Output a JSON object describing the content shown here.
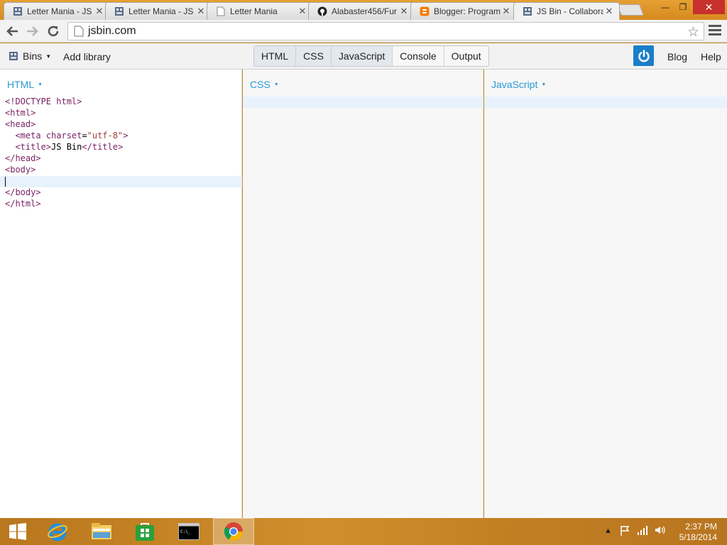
{
  "browser": {
    "tabs": [
      {
        "title": "Letter Mania - JS",
        "icon": "jsbin-icon"
      },
      {
        "title": "Letter Mania - JS",
        "icon": "jsbin-icon"
      },
      {
        "title": "Letter Mania",
        "icon": "page-icon"
      },
      {
        "title": "Alabaster456/Fur",
        "icon": "github-icon"
      },
      {
        "title": "Blogger: Program",
        "icon": "blogger-icon"
      },
      {
        "title": "JS Bin - Collabora",
        "icon": "jsbin-icon"
      }
    ],
    "active_tab": 5,
    "url": "jsbin.com"
  },
  "jsbin": {
    "bins_label": "Bins",
    "add_library": "Add library",
    "panel_toggles": [
      "HTML",
      "CSS",
      "JavaScript",
      "Console",
      "Output"
    ],
    "active_toggles": [
      "HTML",
      "CSS",
      "JavaScript"
    ],
    "blog": "Blog",
    "help": "Help",
    "panels": {
      "html": {
        "label": "HTML",
        "code": [
          "<!DOCTYPE html>",
          "<html>",
          "<head>",
          "  <meta charset=\"utf-8\">",
          "  <title>JS Bin</title>",
          "</head>",
          "<body>",
          "",
          "</body>",
          "</html>"
        ]
      },
      "css": {
        "label": "CSS"
      },
      "js": {
        "label": "JavaScript"
      }
    }
  },
  "taskbar": {
    "items": [
      "start-icon",
      "internet-explorer-icon",
      "file-explorer-icon",
      "store-icon",
      "command-prompt-icon",
      "chrome-icon"
    ],
    "time": "2:37 PM",
    "date": "5/18/2014"
  },
  "colors": {
    "accent_blue": "#2c99d6",
    "power_button": "#1a7ec8",
    "taskbar_orange": "#c98a2a"
  }
}
